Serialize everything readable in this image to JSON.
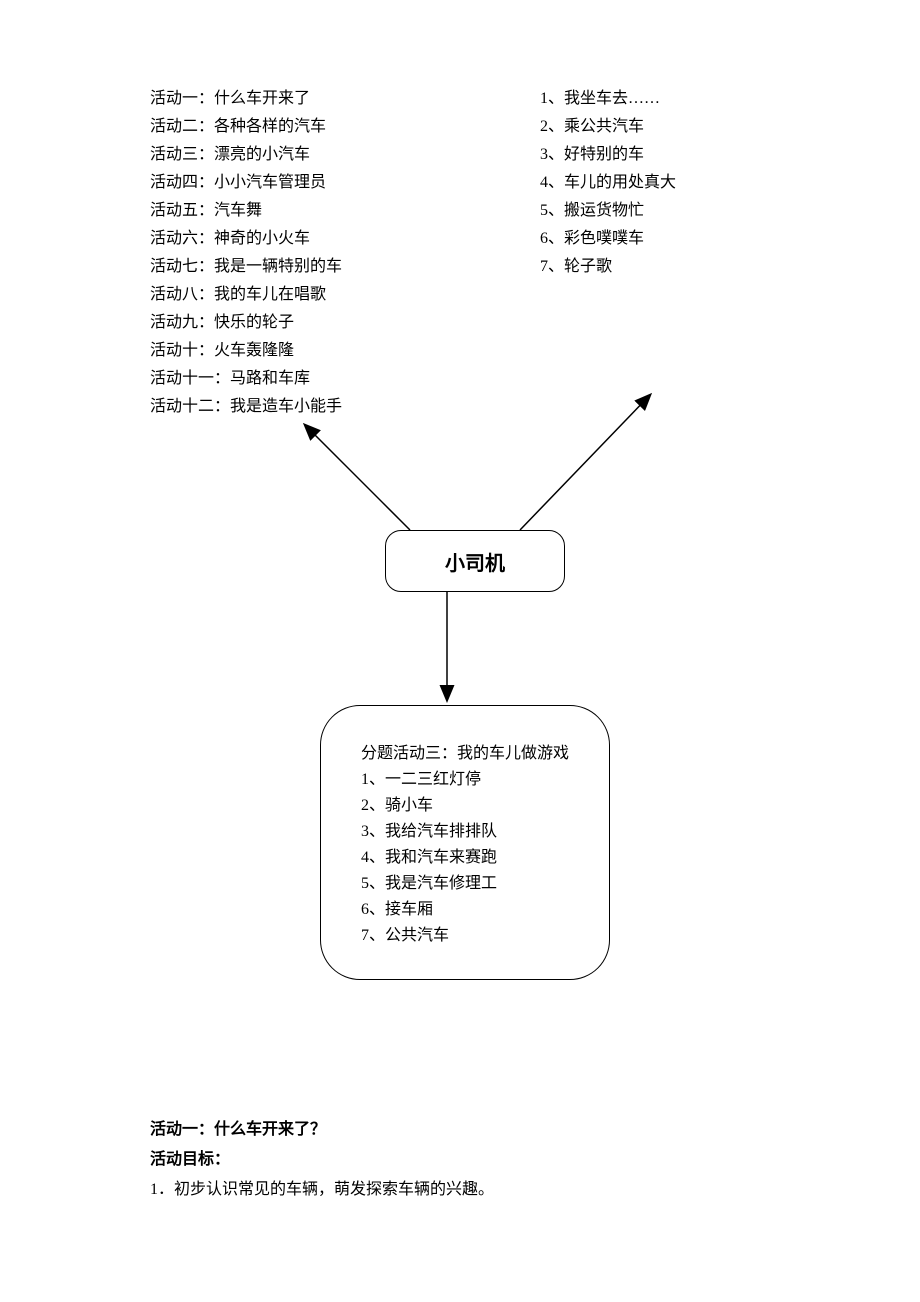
{
  "leftList": {
    "items": [
      "活动一：什么车开来了",
      "活动二：各种各样的汽车",
      "活动三：漂亮的小汽车",
      "活动四：小小汽车管理员",
      "活动五：汽车舞",
      "活动六：神奇的小火车",
      "活动七：我是一辆特别的车",
      "活动八：我的车儿在唱歌",
      "活动九：快乐的轮子",
      "活动十：火车轰隆隆",
      "活动十一：马路和车库",
      "活动十二：我是造车小能手"
    ]
  },
  "rightList": {
    "items": [
      "1、我坐车去……",
      "2、乘公共汽车",
      "3、好特别的车",
      "4、车儿的用处真大",
      "5、搬运货物忙",
      "6、彩色噗噗车",
      "7、轮子歌"
    ]
  },
  "centerBox": {
    "label": "小司机"
  },
  "bottomBox": {
    "title": "分题活动三：我的车儿做游戏",
    "items": [
      "1、一二三红灯停",
      "2、骑小车",
      "3、我给汽车排排队",
      "4、我和汽车来赛跑",
      "5、我是汽车修理工",
      "6、接车厢",
      "7、公共汽车"
    ]
  },
  "footer": {
    "title": "活动一：什么车开来了？",
    "subtitle": "活动目标：",
    "body": "1．初步认识常见的车辆，萌发探索车辆的兴趣。"
  }
}
